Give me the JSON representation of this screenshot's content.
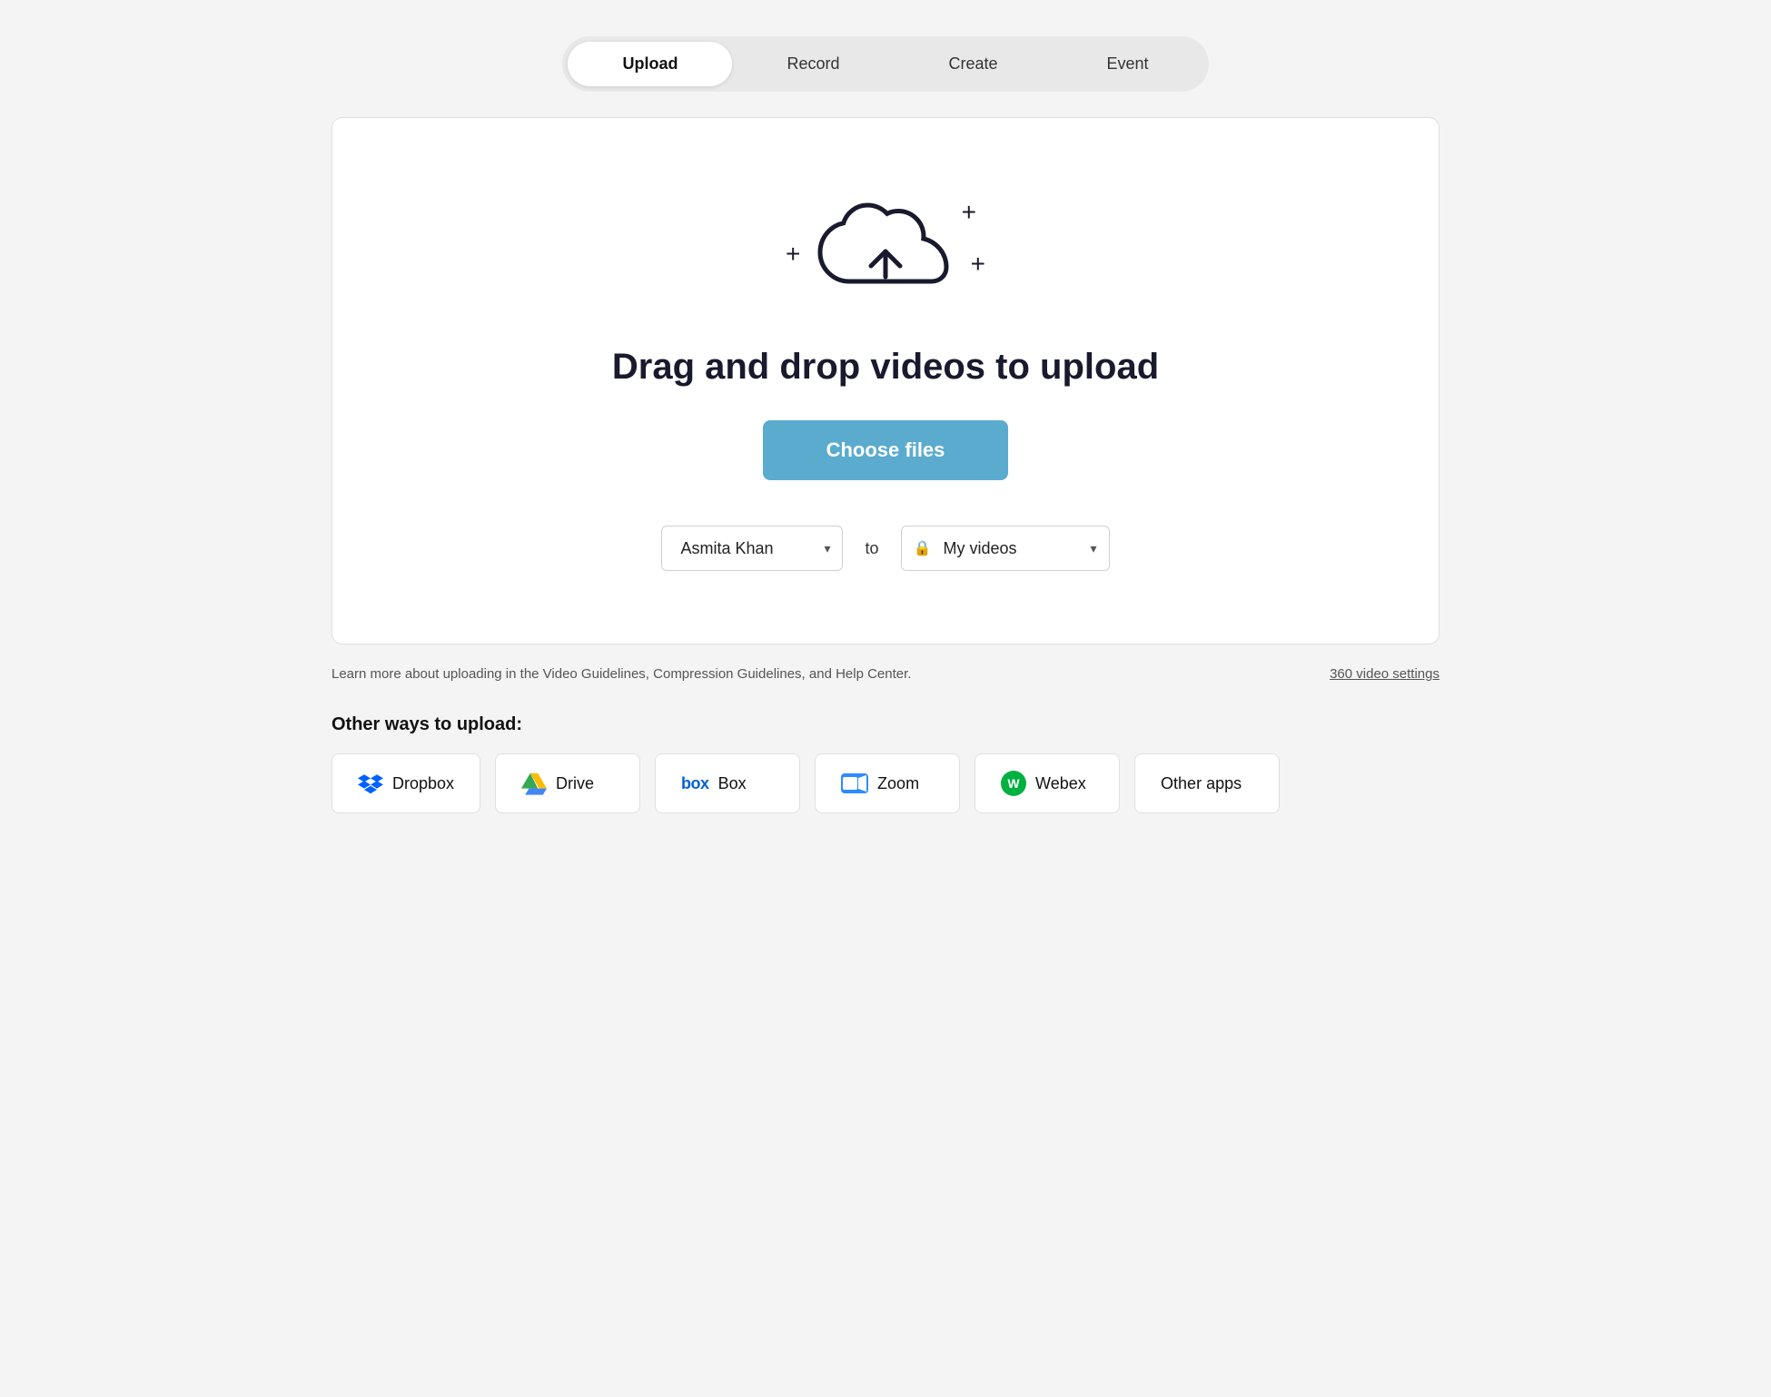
{
  "tabs": [
    {
      "id": "upload",
      "label": "Upload",
      "active": true
    },
    {
      "id": "record",
      "label": "Record",
      "active": false
    },
    {
      "id": "create",
      "label": "Create",
      "active": false
    },
    {
      "id": "event",
      "label": "Event",
      "active": false
    }
  ],
  "upload_area": {
    "drag_drop_text": "Drag and drop videos to upload",
    "choose_files_label": "Choose files",
    "account_name": "Asmita Khan",
    "to_label": "to",
    "destination_label": "My videos"
  },
  "info_bar": {
    "info_text": "Learn more about uploading in the Video Guidelines, Compression Guidelines, and Help Center.",
    "settings_link": "360 video settings"
  },
  "other_ways": {
    "label": "Other ways to upload:",
    "apps": [
      {
        "id": "dropbox",
        "name": "Dropbox"
      },
      {
        "id": "drive",
        "name": "Drive"
      },
      {
        "id": "box",
        "name": "Box"
      },
      {
        "id": "zoom",
        "name": "Zoom"
      },
      {
        "id": "webex",
        "name": "Webex"
      },
      {
        "id": "other",
        "name": "Other apps"
      }
    ]
  },
  "colors": {
    "choose_files_bg": "#5aabce",
    "active_tab_bg": "#ffffff"
  }
}
